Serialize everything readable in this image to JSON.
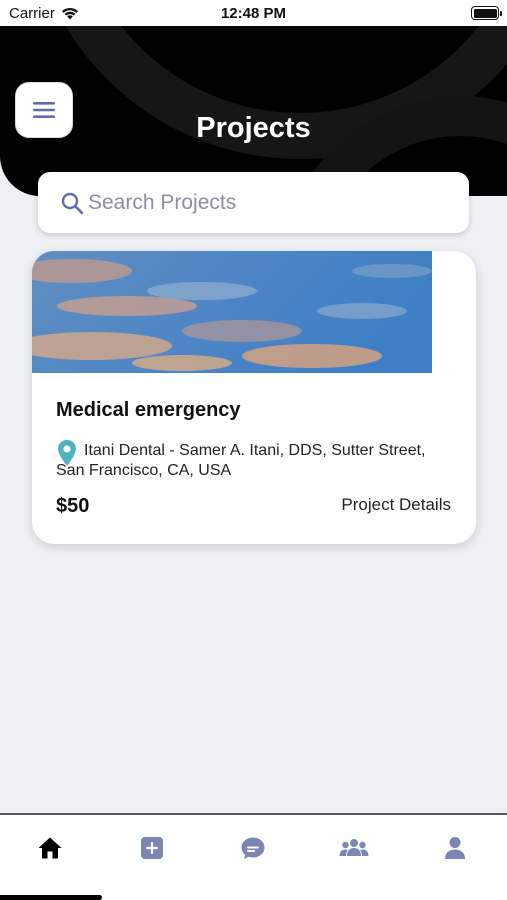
{
  "status_bar": {
    "carrier": "Carrier",
    "time": "12:48 PM"
  },
  "header": {
    "title": "Projects"
  },
  "search": {
    "placeholder": "Search Projects"
  },
  "projects": [
    {
      "title": "Medical emergency",
      "location_line1": "Itani Dental - Samer A. Itani, DDS, Sutter Street,",
      "location_line2": "San Francisco, CA, USA",
      "price": "$50",
      "details_label": "Project Details"
    }
  ],
  "tabs": [
    {
      "icon": "home-icon",
      "active": true
    },
    {
      "icon": "add-square-icon",
      "active": false
    },
    {
      "icon": "chat-bubble-icon",
      "active": false
    },
    {
      "icon": "group-icon",
      "active": false
    },
    {
      "icon": "profile-icon",
      "active": false
    }
  ],
  "colors": {
    "accent": "#7b86b5",
    "header_bg": "#000000",
    "page_bg": "#eef0f4",
    "pin": "#4fb3bf"
  }
}
